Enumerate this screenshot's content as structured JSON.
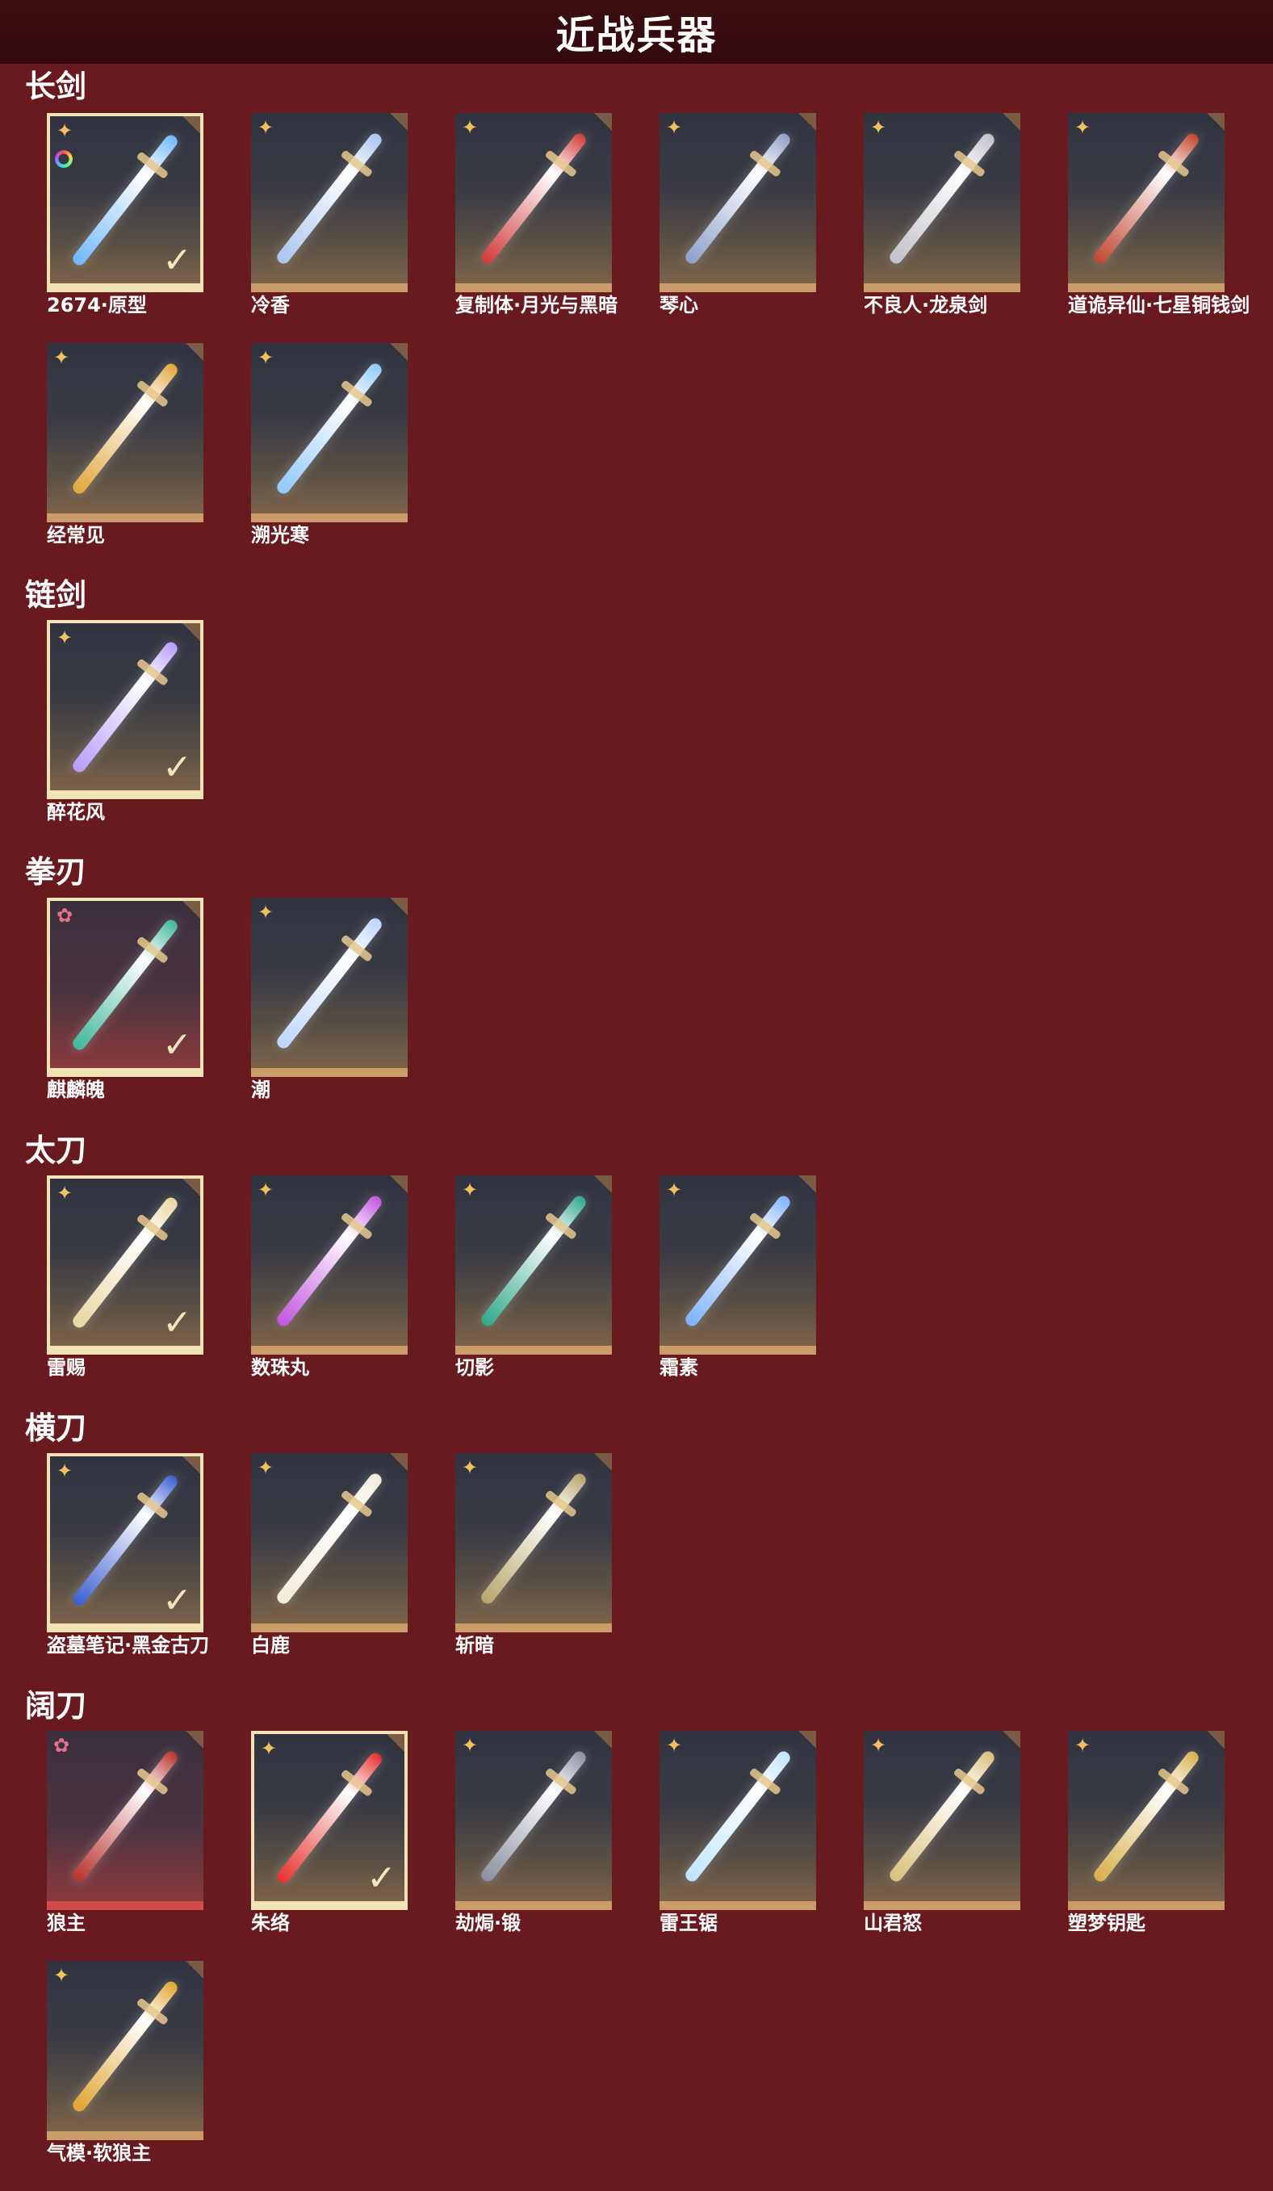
{
  "header": {
    "title": "近战兵器"
  },
  "icons": {
    "rarity": "four-point-star-icon",
    "rarity_red": "flower-star-icon",
    "equipped": "check-icon",
    "color_variant": "rainbow-ring-icon"
  },
  "colors": {
    "background": "#681a1f",
    "header": "#3a0d11",
    "tile_bottom_gold": "#c99c6a",
    "tile_bottom_red": "#d24a4a",
    "equipped_border": "#f1e3b6",
    "rarity_gold": "#f1c15c",
    "rarity_red": "#e6708a"
  },
  "sections": [
    {
      "title": "长剑",
      "items": [
        {
          "name": "2674·原型",
          "rarity": "gold",
          "equipped": true,
          "color_variant": true,
          "weapon_color": "#6fb8ff"
        },
        {
          "name": "冷香",
          "rarity": "gold",
          "weapon_color": "#a8c4f0"
        },
        {
          "name": "复制体·月光与黑暗",
          "rarity": "gold",
          "weapon_color": "#d23a3a"
        },
        {
          "name": "琴心",
          "rarity": "gold",
          "weapon_color": "#8ea0c9"
        },
        {
          "name": "不良人·龙泉剑",
          "rarity": "gold",
          "weapon_color": "#c0c0c8"
        },
        {
          "name": "道诡异仙·七星铜钱剑",
          "rarity": "gold",
          "weapon_color": "#c2452e"
        },
        {
          "name": "经常见",
          "rarity": "gold",
          "weapon_color": "#e0a63a"
        },
        {
          "name": "溯光寒",
          "rarity": "gold",
          "weapon_color": "#8fc8ff"
        }
      ]
    },
    {
      "title": "链剑",
      "items": [
        {
          "name": "醉花风",
          "rarity": "gold",
          "equipped": true,
          "weapon_color": "#b79cff"
        }
      ]
    },
    {
      "title": "拳刃",
      "items": [
        {
          "name": "麒麟魄",
          "rarity": "red",
          "equipped": true,
          "weapon_color": "#3fb79a"
        },
        {
          "name": "潮",
          "rarity": "gold",
          "weapon_color": "#bcd6ff"
        }
      ]
    },
    {
      "title": "太刀",
      "items": [
        {
          "name": "雷赐",
          "rarity": "gold",
          "equipped": true,
          "weapon_color": "#e8d6a0"
        },
        {
          "name": "数珠丸",
          "rarity": "gold",
          "weapon_color": "#c254e0"
        },
        {
          "name": "切影",
          "rarity": "gold",
          "weapon_color": "#2fa88a"
        },
        {
          "name": "霜素",
          "rarity": "gold",
          "weapon_color": "#7eb2ff"
        }
      ]
    },
    {
      "title": "横刀",
      "items": [
        {
          "name": "盗墓笔记·黑金古刀",
          "rarity": "gold",
          "equipped": true,
          "weapon_color": "#3c5fd0"
        },
        {
          "name": "白鹿",
          "rarity": "gold",
          "weapon_color": "#f1eadb"
        },
        {
          "name": "斩暗",
          "rarity": "gold",
          "weapon_color": "#b6a66a"
        }
      ]
    },
    {
      "title": "阔刀",
      "items": [
        {
          "name": "狼主",
          "rarity": "red",
          "weapon_color": "#b8322e"
        },
        {
          "name": "朱络",
          "rarity": "gold",
          "equipped": true,
          "weapon_color": "#e8302c"
        },
        {
          "name": "劫焗·锻",
          "rarity": "gold",
          "weapon_color": "#8a8fa0"
        },
        {
          "name": "雷王锯",
          "rarity": "gold",
          "weapon_color": "#bfe4ff"
        },
        {
          "name": "山君怒",
          "rarity": "gold",
          "weapon_color": "#d9c07a"
        },
        {
          "name": "塑梦钥匙",
          "rarity": "gold",
          "weapon_color": "#d8b04a"
        },
        {
          "name": "气模·软狼主",
          "rarity": "gold",
          "weapon_color": "#e0a430"
        }
      ]
    }
  ]
}
